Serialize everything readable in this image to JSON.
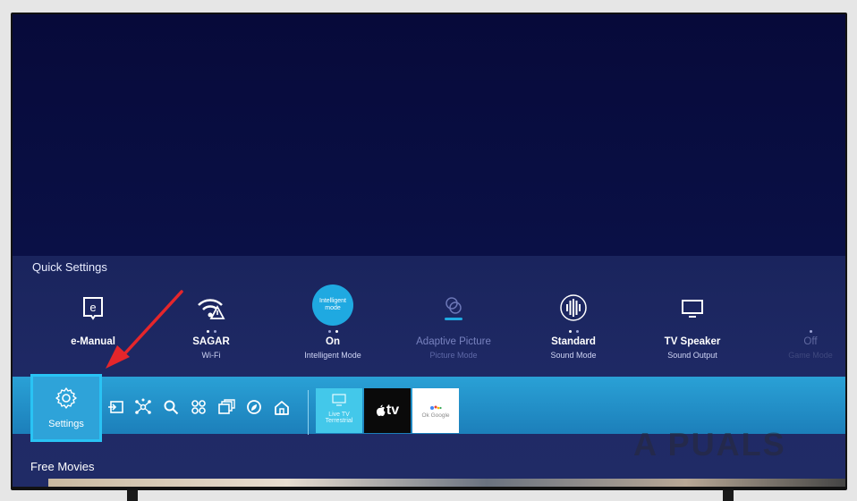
{
  "quick_settings": {
    "title": "Quick Settings",
    "items": [
      {
        "icon": "e-manual-icon",
        "value": "e-Manual",
        "label": ""
      },
      {
        "icon": "wifi-warning-icon",
        "value": "SAGAR",
        "label": "Wi-Fi"
      },
      {
        "icon": "intelligent-mode-icon",
        "icon_text": "Intelligent mode",
        "value": "On",
        "label": "Intelligent Mode"
      },
      {
        "icon": "adaptive-picture-icon",
        "value": "Adaptive Picture",
        "label": "Picture Mode"
      },
      {
        "icon": "sound-mode-icon",
        "value": "Standard",
        "label": "Sound Mode"
      },
      {
        "icon": "tv-speaker-icon",
        "value": "TV Speaker",
        "label": "Sound Output"
      },
      {
        "icon": "game-mode-icon",
        "value": "Off",
        "label": "Game Mode"
      }
    ]
  },
  "launcher": {
    "settings_label": "Settings",
    "icons": [
      "source-icon",
      "connected-devices-icon",
      "search-icon",
      "apps-icon",
      "multi-view-icon",
      "ambient-icon",
      "home-icon"
    ],
    "apps": {
      "live_tv": {
        "line1": "Live TV",
        "line2": "Terrestrial"
      },
      "apple_tv": {
        "label": "tv"
      },
      "google": {
        "label": "Ok Google"
      }
    }
  },
  "free_movies": {
    "title": "Free Movies"
  },
  "watermark": "A PUALS",
  "colors": {
    "accent": "#29a3dc",
    "highlight": "#29c3f4",
    "panel": "#1f2a66",
    "arrow": "#e5262b"
  }
}
